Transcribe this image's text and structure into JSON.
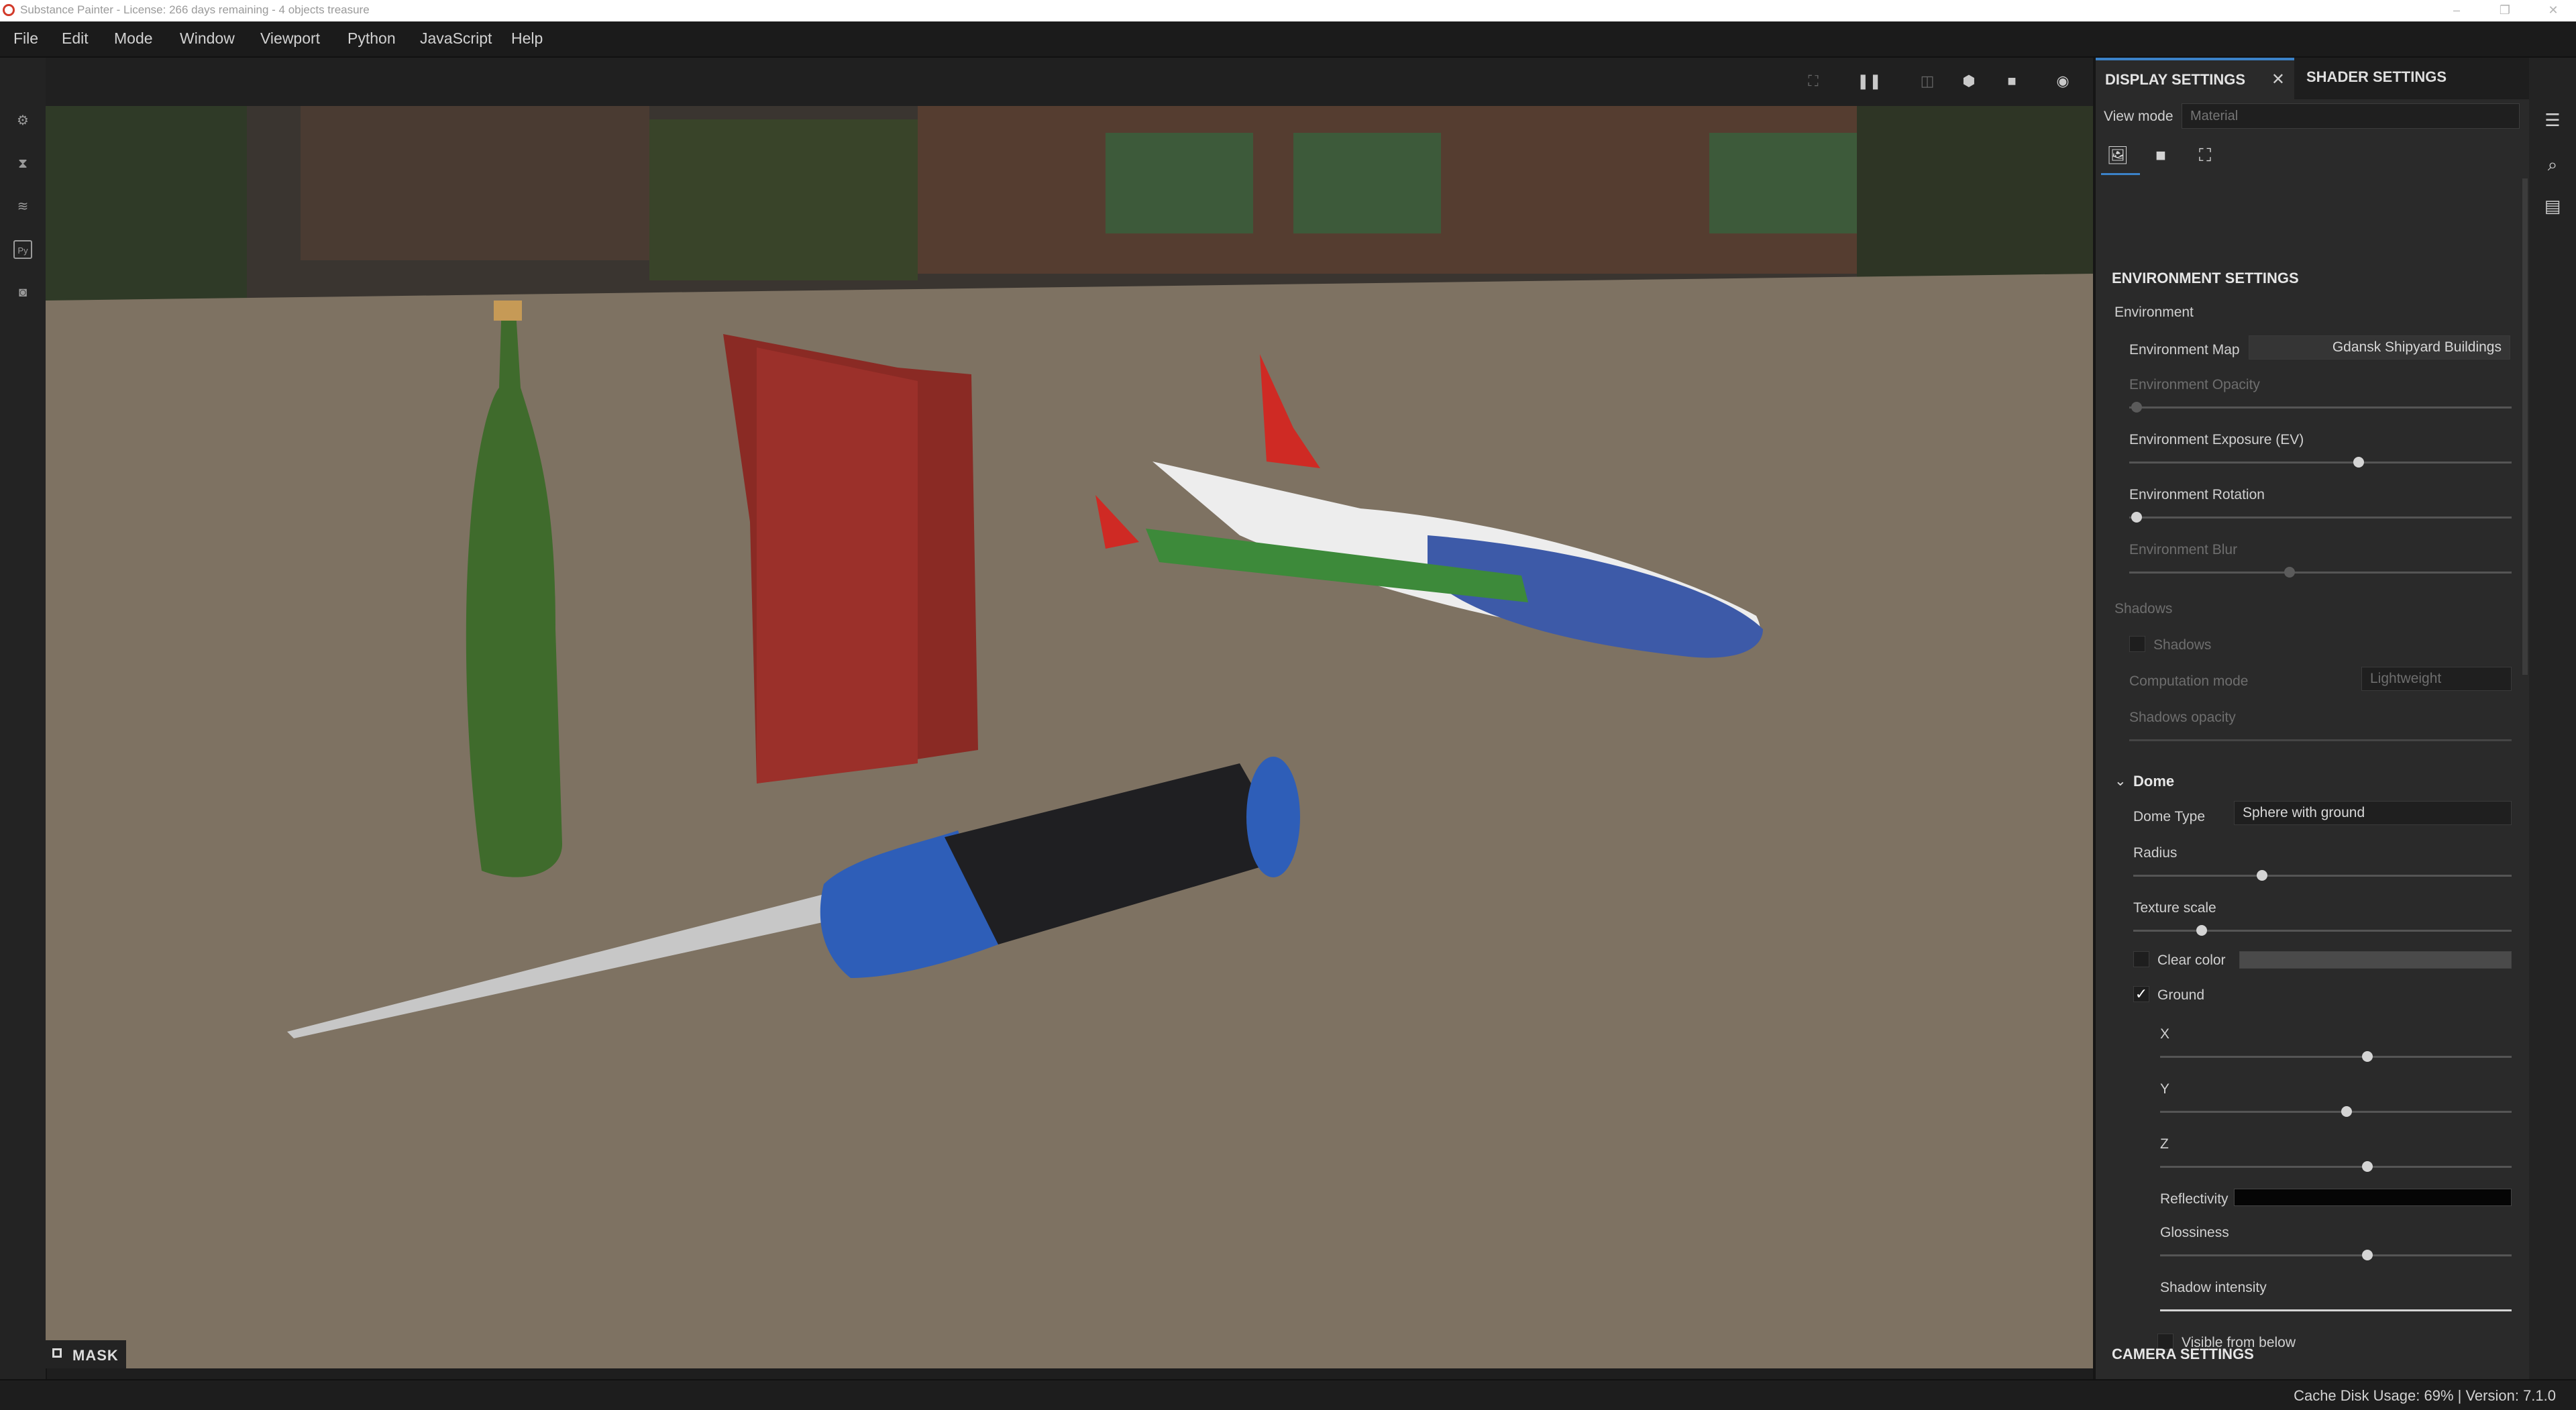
{
  "window": {
    "title": "Substance Painter - License: 266 days remaining - 4 objects treasure"
  },
  "menu": [
    "File",
    "Edit",
    "Mode",
    "Window",
    "Viewport",
    "Python",
    "JavaScript",
    "Help"
  ],
  "viewport": {
    "mask_label": "MASK"
  },
  "panel": {
    "tabs": {
      "display": "DISPLAY SETTINGS",
      "shader": "SHADER SETTINGS",
      "close": "✕"
    },
    "view_mode": {
      "label": "View mode",
      "placeholder": "Material"
    },
    "environment_settings": {
      "title": "ENVIRONMENT SETTINGS",
      "group": "Environment",
      "env_map": {
        "label": "Environment Map",
        "value": "Gdansk Shipyard Buildings"
      },
      "env_opacity": {
        "label": "Environment Opacity",
        "value": 0.0
      },
      "env_exposure": {
        "label": "Environment Exposure (EV)",
        "value": 0.6
      },
      "env_rotation": {
        "label": "Environment Rotation",
        "value": 0.0
      },
      "env_blur": {
        "label": "Environment Blur",
        "value": 0.42
      },
      "shadows_group": "Shadows",
      "shadows_check": {
        "label": "Shadows",
        "checked": false
      },
      "computation_mode": {
        "label": "Computation mode",
        "value": "Lightweight"
      },
      "shadows_opacity": {
        "label": "Shadows opacity"
      }
    },
    "dome": {
      "title": "Dome",
      "dome_type": {
        "label": "Dome Type",
        "value": "Sphere with ground"
      },
      "radius": {
        "label": "Radius",
        "value": 0.34
      },
      "texture_scale": {
        "label": "Texture scale",
        "value": 0.18
      },
      "clear_color": {
        "label": "Clear color",
        "checked": false
      },
      "ground": {
        "label": "Ground",
        "checked": true,
        "check": "✓"
      },
      "x": {
        "label": "X",
        "value": 0.59
      },
      "y": {
        "label": "Y",
        "value": 0.53
      },
      "z": {
        "label": "Z",
        "value": 0.59
      },
      "reflectivity": {
        "label": "Reflectivity"
      },
      "glossiness": {
        "label": "Glossiness",
        "value": 0.59
      },
      "shadow_intensity": {
        "label": "Shadow intensity",
        "value": 1.0
      },
      "visible_from_below": {
        "label": "Visible from below",
        "checked": false
      }
    },
    "camera_settings": {
      "title": "CAMERA SETTINGS"
    }
  },
  "status": {
    "text": "Cache Disk Usage: 69% | Version: 7.1.0"
  },
  "colors": {
    "accent": "#3b82c8",
    "panel_bg": "#2a2a2a",
    "brand": "#d23a2a"
  },
  "icons": {
    "left_toolbar": [
      "settings-icon",
      "hourglass-icon",
      "layers-icon",
      "python-icon",
      "camera-icon"
    ],
    "viewport_toolbar": [
      "screenshot-icon",
      "pause-icon",
      "split-view-icon",
      "cube-icon",
      "video-camera-icon",
      "camera-icon"
    ],
    "panel_modes": [
      "image-icon",
      "video-icon",
      "frame-icon"
    ],
    "right_toolbar": [
      "layers-stack-icon",
      "zoom-icon",
      "document-icon"
    ]
  }
}
